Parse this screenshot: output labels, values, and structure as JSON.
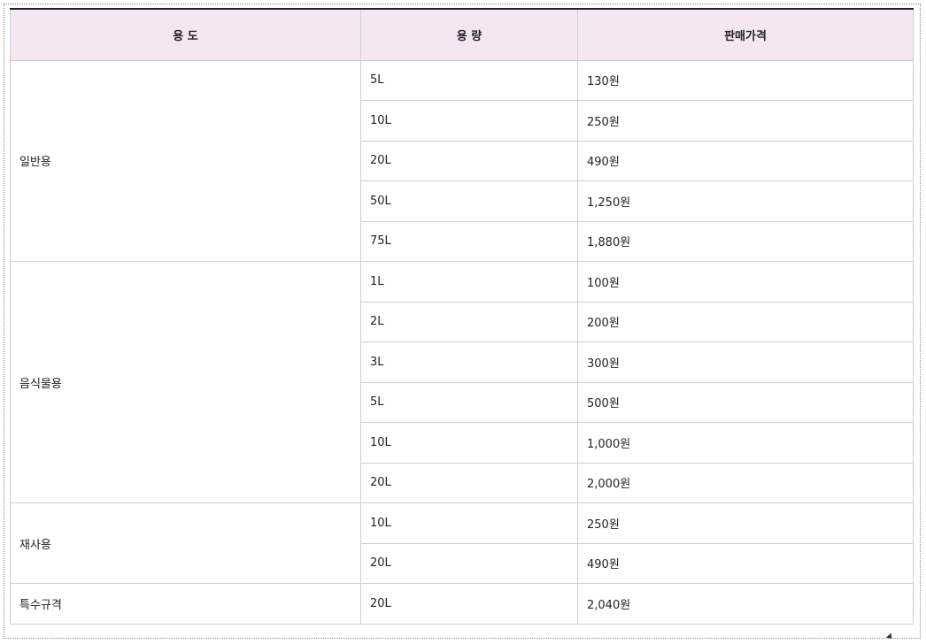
{
  "table": {
    "headers": [
      "용 도",
      "용 량",
      "판매가격"
    ],
    "groups": [
      {
        "usage": "일반용",
        "rows": [
          {
            "capacity": "5L",
            "price": "130원"
          },
          {
            "capacity": "10L",
            "price": "250원"
          },
          {
            "capacity": "20L",
            "price": "490원"
          },
          {
            "capacity": "50L",
            "price": "1,250원"
          },
          {
            "capacity": "75L",
            "price": "1,880원"
          }
        ]
      },
      {
        "usage": "음식물용",
        "rows": [
          {
            "capacity": "1L",
            "price": "100원"
          },
          {
            "capacity": "2L",
            "price": "200원"
          },
          {
            "capacity": "3L",
            "price": "300원"
          },
          {
            "capacity": "5L",
            "price": "500원"
          },
          {
            "capacity": "10L",
            "price": "1,000원"
          },
          {
            "capacity": "20L",
            "price": "2,000원"
          }
        ]
      },
      {
        "usage": "재사용",
        "rows": [
          {
            "capacity": "10L",
            "price": "250원"
          },
          {
            "capacity": "20L",
            "price": "490원"
          }
        ]
      },
      {
        "usage": "특수규격",
        "rows": [
          {
            "capacity": "20L",
            "price": "2,040원"
          }
        ]
      }
    ]
  }
}
